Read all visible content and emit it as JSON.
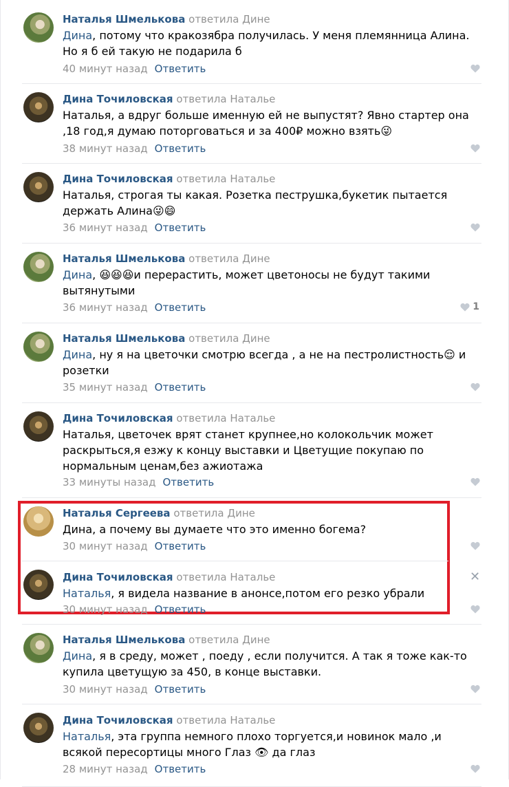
{
  "like_color": "#c5cbd3",
  "accent": "#2a5885",
  "highlight_color": "#e01e2a",
  "comments": [
    {
      "avatar": "natalia",
      "author": "Наталья Шмелькова",
      "replied": "ответила Дине",
      "mention": "Дина",
      "text": ", потому что кракозябра получилась. У меня племянница Алина. Но я б ей такую не подарила б",
      "time": "40 минут назад",
      "reply_label": "Ответить",
      "likes": ""
    },
    {
      "avatar": "dina",
      "author": "Дина Точиловская",
      "replied": "ответила Наталье",
      "mention": "",
      "text": "Наталья, а вдруг больше именную ей не выпустят? Явно стартер она ,18 год,я думаю поторговаться и за 400₽ можно взять😜",
      "time": "38 минут назад",
      "reply_label": "Ответить",
      "likes": ""
    },
    {
      "avatar": "dina",
      "author": "Дина Точиловская",
      "replied": "ответила Наталье",
      "mention": "",
      "text": "Наталья, строгая ты какая. Розетка пеструшка,букетик пытается держать Алина😜😄",
      "time": "36 минут назад",
      "reply_label": "Ответить",
      "likes": ""
    },
    {
      "avatar": "natalia",
      "author": "Наталья Шмелькова",
      "replied": "ответила Дине",
      "mention": "Дина",
      "text": ", 😆😆😆и перерастить, может цветоносы не будут такими вытянутыми",
      "time": "36 минут назад",
      "reply_label": "Ответить",
      "likes": "1"
    },
    {
      "avatar": "natalia",
      "author": "Наталья Шмелькова",
      "replied": "ответила Дине",
      "mention": "Дина",
      "text": ", ну я на цветочки смотрю всегда , а не на пестролистность😌 и розетки",
      "time": "35 минут назад",
      "reply_label": "Ответить",
      "likes": ""
    },
    {
      "avatar": "dina",
      "author": "Дина Точиловская",
      "replied": "ответила Наталье",
      "mention": "",
      "text": "Наталья, цветочек врят станет крупнее,но колокольчик может раскрыться,я езжу к концу выставки и Цветущие покупаю по нормальным ценам,без ажиотажа",
      "time": "33 минуты назад",
      "reply_label": "Ответить",
      "likes": ""
    },
    {
      "avatar": "sergeeva",
      "author": "Наталья Сергеева",
      "replied": "ответила Дине",
      "mention": "",
      "text": "Дина, а почему вы думаете что это именно богема?",
      "time": "30 минут назад",
      "reply_label": "Ответить",
      "likes": ""
    },
    {
      "avatar": "dina",
      "author": "Дина Точиловская",
      "replied": "ответила Наталье",
      "mention": "Наталья",
      "text": ", я видела название в анонсе,потом его резко убрали",
      "time": "30 минут назад",
      "reply_label": "Ответить",
      "likes": "",
      "close": "✕"
    },
    {
      "avatar": "natalia",
      "author": "Наталья Шмелькова",
      "replied": "ответила Дине",
      "mention": "Дина",
      "text": ", я в среду, может , поеду , если получится. А так я тоже как-то купила цветущую за 450, в конце выставки.",
      "time": "30 минут назад",
      "reply_label": "Ответить",
      "likes": ""
    },
    {
      "avatar": "dina",
      "author": "Дина Точиловская",
      "replied": "ответила Наталье",
      "mention": "Наталья",
      "text": ", эта группа немного плохо торгуется,и новинок мало ,и всякой пересортицы много Глаз 👁 да глаз",
      "time": "28 минут назад",
      "reply_label": "Ответить",
      "likes": ""
    }
  ]
}
